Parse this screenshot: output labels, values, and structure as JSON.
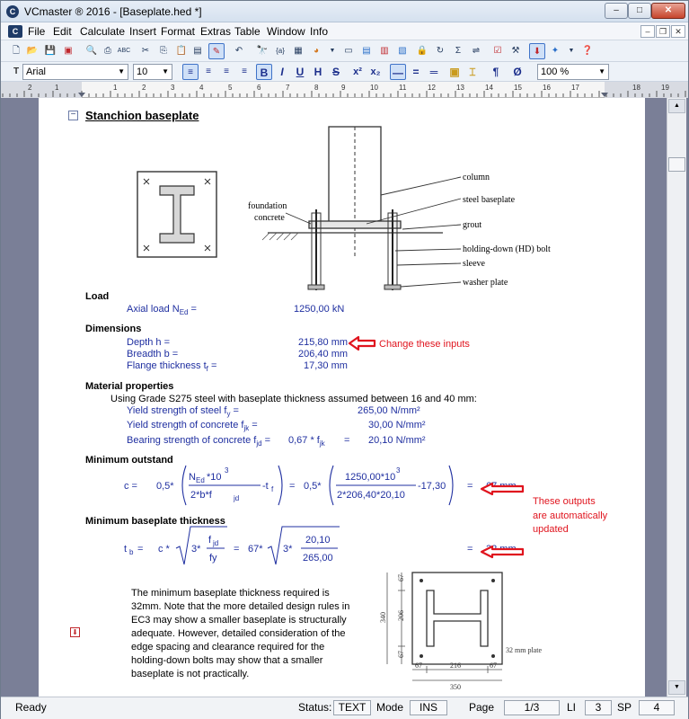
{
  "window": {
    "title": "VCmaster ® 2016 - [Baseplate.hed *]",
    "icon_letter": "C",
    "min": "–",
    "max": "□",
    "close": "✕"
  },
  "menu": [
    "File",
    "Edit",
    "Calculate",
    "Insert",
    "Format",
    "Extras",
    "Table",
    "Window",
    "Info"
  ],
  "mdi": {
    "min": "–",
    "restore": "❐",
    "close": "✕"
  },
  "format": {
    "font": "Arial",
    "size": "10",
    "zoom": "100 %",
    "bold": "B",
    "italic": "I",
    "underline": "U",
    "highlight": "H",
    "strike": "S",
    "sup": "x²",
    "sub": "x₂",
    "para": "¶",
    "empty": "Ø"
  },
  "ruler": [
    "2",
    "1",
    "1",
    "2",
    "3",
    "4",
    "5",
    "6",
    "7",
    "8",
    "9",
    "10",
    "11",
    "12",
    "13",
    "14",
    "15",
    "16",
    "17",
    "18",
    "19"
  ],
  "doc": {
    "section_title": "Stanchion baseplate",
    "fig1": {
      "foundation": "foundation",
      "concrete": "concrete",
      "column": "column",
      "steel_baseplate": "steel baseplate",
      "grout": "grout",
      "hd_bolt": "holding-down (HD) bolt",
      "sleeve": "sleeve",
      "washer": "washer plate"
    },
    "load": {
      "heading": "Load",
      "label_pre": "Axial load N",
      "label_sub": "Ed",
      "label_post": " =",
      "value": "1250,00 kN"
    },
    "dimensions": {
      "heading": "Dimensions",
      "depth_label": "Depth h =",
      "depth_value": "215,80 mm",
      "breadth_label": "Breadth b =",
      "breadth_value": "206,40 mm",
      "flange_label": "Flange thickness t",
      "flange_sub": "f",
      "flange_post": " =",
      "flange_value": "17,30 mm"
    },
    "annotations": {
      "inputs": "Change these inputs",
      "outputs1": "These outputs",
      "outputs2": "are automatically",
      "outputs3": "updated"
    },
    "material": {
      "heading": "Material properties",
      "intro": "Using Grade S275 steel with baseplate thickness assumed between 16 and 40 mm:",
      "fy_label": "Yield strength of steel f",
      "fy_sub": "y",
      "fy_post": " =",
      "fy_value": "265,00 N/mm²",
      "fjk_label": "Yield strength of concrete f",
      "fjk_sub": "jk",
      "fjk_post": " =",
      "fjk_value": "30,00 N/mm²",
      "fjd_label": "Bearing strength of concrete f",
      "fjd_sub": "jd",
      "fjd_post": " =",
      "fjd_expr": "0,67 * f",
      "fjd_expr_sub": "jk",
      "fjd_eq": "=",
      "fjd_value": "20,10 N/mm²"
    },
    "outstand": {
      "heading": "Minimum outstand",
      "lhs": "c =",
      "coef": "0,5*",
      "ned": "N",
      "ned_sub": "Ed",
      "times10": "*10",
      "exp": "3",
      "den": "2*b*f",
      "den_sub": "jd",
      "minus_tf": "-t",
      "tf_sub": "f",
      "eq1": "=",
      "coef2": "0,5*",
      "num2": "1250,00*10",
      "exp2": "3",
      "den2": "2*206,40*20,10",
      "minus2": "-17,30",
      "eq2": "=",
      "result": "67 mm"
    },
    "thickness": {
      "heading": "Minimum baseplate thickness",
      "lhs": "t",
      "lhs_sub": "b",
      "lhs_eq": "=",
      "c": "c *",
      "three": "3*",
      "fjd": "f",
      "fjd_sub": "jd",
      "fy": "fy",
      "eq1": "=",
      "c67": "67*",
      "three2": "3*",
      "num": "20,10",
      "den": "265,00",
      "eq2": "=",
      "result": "32 mm"
    },
    "para": [
      "The minimum baseplate thickness required is",
      "32mm. Note that the more detailed design rules in",
      "EC3 may show a smaller baseplate is structurally",
      "adequate. However, detailed consideration of the",
      "edge spacing and clearance required for the",
      "holding-down bolts may show that a smaller",
      "baseplate is not practically."
    ],
    "fig2": {
      "d67a": "67",
      "d206": "206",
      "d67b": "67",
      "d340": "340",
      "b67a": "67",
      "b216": "216",
      "b67b": "67",
      "b350": "350",
      "plate": "32 mm plate"
    }
  },
  "status": {
    "ready": "Ready",
    "status_label": "Status:",
    "status_value": "TEXT",
    "mode_label": "Mode",
    "mode_value": "INS",
    "page_label": "Page",
    "page_value": "1/3",
    "li_label": "LI",
    "li_value": "3",
    "sp_label": "SP",
    "sp_value": "4"
  }
}
